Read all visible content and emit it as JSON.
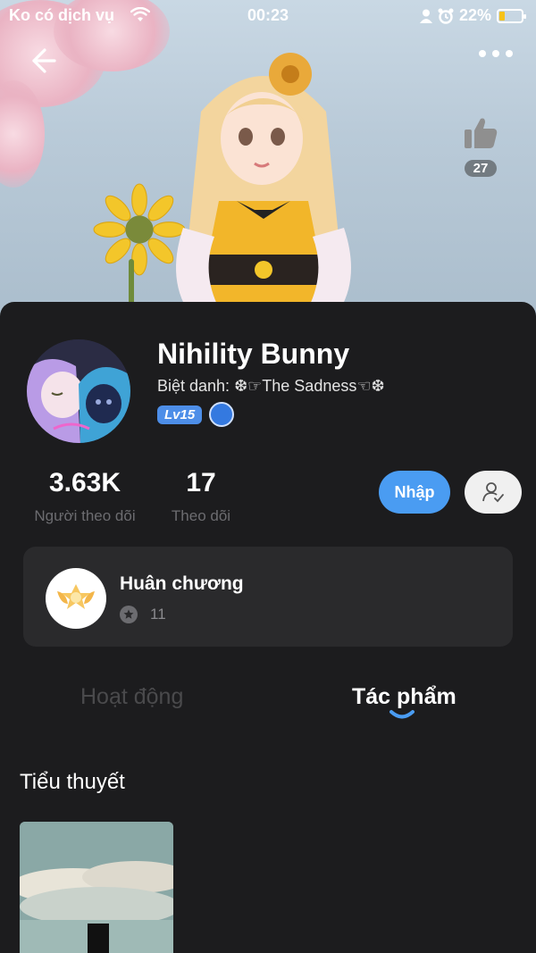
{
  "status_bar": {
    "carrier": "Ko có dịch vụ",
    "time": "00:23",
    "battery": "22%"
  },
  "header": {
    "likes": "27"
  },
  "profile": {
    "name": "Nihility Bunny",
    "nickname": "Biệt danh: ❆☞The Sadness☜❆",
    "level": "Lv15"
  },
  "stats": [
    {
      "value": "3.63K",
      "label": "Người theo dõi"
    },
    {
      "value": "17",
      "label": "Theo dõi"
    }
  ],
  "actions": {
    "enter_label": "Nhập"
  },
  "medals": {
    "title": "Huân chương",
    "count": "11"
  },
  "tabs": [
    {
      "label": "Hoạt động",
      "active": false
    },
    {
      "label": "Tác phẩm",
      "active": true
    }
  ],
  "section": {
    "title": "Tiểu thuyết"
  },
  "colors": {
    "accent": "#4a9cf2",
    "background": "#1c1c1e",
    "card": "#2a2a2c"
  }
}
